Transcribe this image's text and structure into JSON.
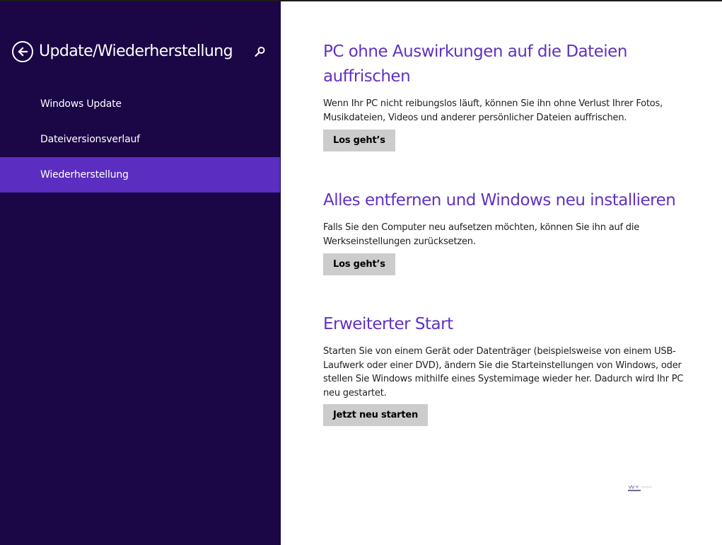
{
  "sidebar": {
    "title": "Update/Wiederherstellung",
    "items": [
      {
        "label": "Windows Update",
        "active": false
      },
      {
        "label": "Dateiversionsverlauf",
        "active": false
      },
      {
        "label": "Wiederherstellung",
        "active": true
      }
    ]
  },
  "main": {
    "sections": [
      {
        "title": "PC ohne Auswirkungen auf die Dateien auffrischen",
        "description": "Wenn Ihr PC nicht reibungslos läuft, können Sie ihn ohne Verlust Ihrer Fotos, Musikdateien, Videos und anderer persönlicher Dateien auffrischen.",
        "button": "Los geht’s"
      },
      {
        "title": "Alles entfernen und Windows neu installieren",
        "description": "Falls Sie den Computer neu aufsetzen möchten, können Sie ihn auf die Werkseinstellungen zurücksetzen.",
        "button": "Los geht’s"
      },
      {
        "title": "Erweiterter Start",
        "description": "Starten Sie von einem Gerät oder Datenträger (beispielsweise von einem USB-Laufwerk oder einer DVD), ändern Sie die Starteinstellungen von Windows, oder stellen Sie Windows mithilfe eines Systemimage wieder her. Dadurch wird Ihr PC neu gestartet.",
        "button": "Jetzt neu starten"
      }
    ]
  },
  "colors": {
    "sidebar_bg": "#1b0646",
    "sidebar_active": "#5b2dc0",
    "accent_title": "#6032c2",
    "button_bg": "#cccccc"
  },
  "icons": {
    "back": "back-arrow-circle-icon",
    "search": "search-icon"
  }
}
